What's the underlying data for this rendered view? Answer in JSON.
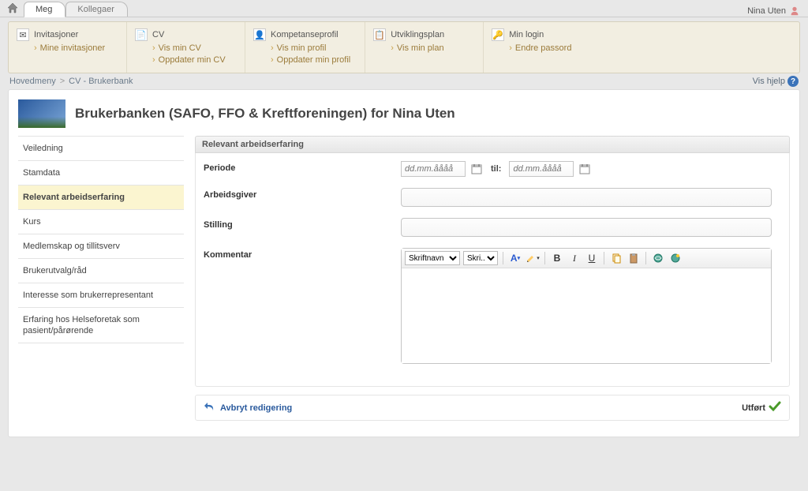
{
  "tabs": {
    "active": "Meg",
    "inactive": "Kollegaer"
  },
  "user": "Nina Uten",
  "toolbar": {
    "g1": {
      "title": "Invitasjoner",
      "link1": "Mine invitasjoner"
    },
    "g2": {
      "title": "CV",
      "link1": "Vis min CV",
      "link2": "Oppdater min CV"
    },
    "g3": {
      "title": "Kompetanseprofil",
      "link1": "Vis min profil",
      "link2": "Oppdater min profil"
    },
    "g4": {
      "title": "Utviklingsplan",
      "link1": "Vis min plan"
    },
    "g5": {
      "title": "Min login",
      "link1": "Endre passord"
    }
  },
  "breadcrumb": {
    "a": "Hovedmeny",
    "b": "CV - Brukerbank",
    "help": "Vis hjelp"
  },
  "page_title": "Brukerbanken (SAFO, FFO & Kreftforeningen) for Nina Uten",
  "menu": {
    "m1": "Veiledning",
    "m2": "Stamdata",
    "m3": "Relevant arbeidserfaring",
    "m4": "Kurs",
    "m5": "Medlemskap og tillitsverv",
    "m6": "Brukerutvalg/råd",
    "m7": "Interesse som brukerrepresentant",
    "m8": "Erfaring hos Helseforetak som pasient/pårørende"
  },
  "section_head": "Relevant arbeidserfaring",
  "labels": {
    "periode": "Periode",
    "til": "til:",
    "arbeidsgiver": "Arbeidsgiver",
    "stilling": "Stilling",
    "kommentar": "Kommentar"
  },
  "placeholders": {
    "date": "dd.mm.åååå"
  },
  "editor": {
    "font_dd": "Skriftnavn",
    "size_dd": "Skri..."
  },
  "actions": {
    "cancel": "Avbryt redigering",
    "done": "Utført"
  }
}
